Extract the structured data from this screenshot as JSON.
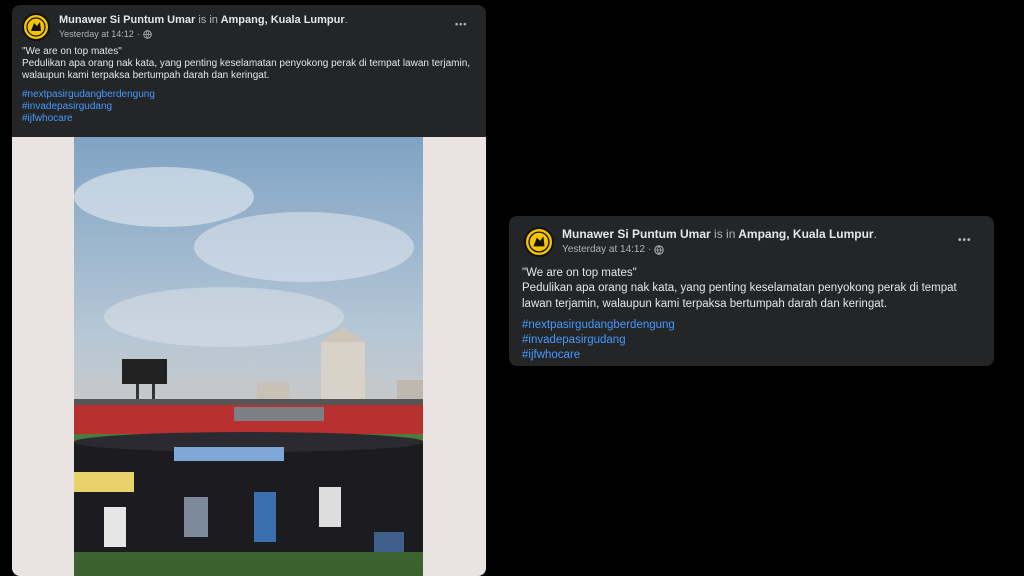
{
  "post": {
    "author": "Munawer Si Puntum Umar",
    "is_in": "is in",
    "location": "Ampang, Kuala Lumpur",
    "period": ".",
    "time": "Yesterday at 14:12",
    "dot": "·",
    "privacy_icon": "globe-icon",
    "more_label": "•••",
    "quote": "\"We are on top mates\"",
    "message": "Pedulikan apa orang nak kata, yang penting keselamatan penyokong perak di tempat lawan terjamin, walaupun kami terpaksa bertumpah darah dan keringat.",
    "hashtags": [
      "#nextpasirgudangberdengung",
      "#invadepasirgudang",
      "#ijfwhocare"
    ]
  },
  "colors": {
    "card": "#242526",
    "link": "#4599ff",
    "avatar": "#f5c400"
  }
}
